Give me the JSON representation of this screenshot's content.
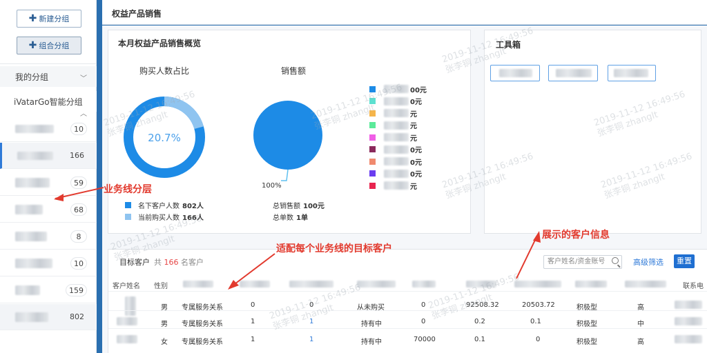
{
  "sidebar": {
    "new_group": "新建分组",
    "combine_group": "组合分组",
    "my_groups": "我的分组",
    "smart_groups": "iVatarGo智能分组",
    "counts": [
      "10",
      "166",
      "59",
      "68",
      "8",
      "10",
      "159",
      "802"
    ]
  },
  "header": {
    "title": "权益产品销售"
  },
  "overview": {
    "title": "本月权益产品销售概览",
    "buyers_title": "购买人数占比",
    "donut_percent": "20.7%",
    "donut_fraction": 0.207,
    "sales_title": "销售额",
    "pie_label": "100%",
    "legend_total_label": "名下客户人数",
    "legend_total_value": "802人",
    "legend_buyers_label": "当前购买人数",
    "legend_buyers_value": "166人",
    "sales_total_label": "总销售额",
    "sales_total_value": "100元",
    "orders_label": "总单数",
    "orders_value": "1单",
    "colors": [
      "#1d8be6",
      "#5de0d0",
      "#f5b54b",
      "#5bea9a",
      "#f05ee6",
      "#8b2a5c",
      "#f08a6e",
      "#6a3df0",
      "#e8254f"
    ],
    "color_values": [
      "00元",
      "0元",
      "元",
      "元",
      "元",
      "0元",
      "0元",
      "0元",
      "元"
    ]
  },
  "toolbox": {
    "title": "工具箱"
  },
  "targets": {
    "title": "目标客户",
    "count_prefix": "共",
    "count": "166",
    "count_suffix": "名客户",
    "search_placeholder": "客户姓名/资金账号",
    "advanced_filter": "高级筛选",
    "reset": "重置",
    "headers": [
      "客户姓名",
      "性别",
      "联系电"
    ],
    "rows": [
      {
        "gender": "男",
        "relation": "专属服务关系",
        "c1": "0",
        "c2": "0",
        "status": "从未购买",
        "c3": "0",
        "c4": "92508.32",
        "c5": "20503.72",
        "type": "积极型",
        "level": "高"
      },
      {
        "gender": "男",
        "relation": "专属服务关系",
        "c1": "1",
        "c2": "1",
        "status": "持有中",
        "c3": "0",
        "c4": "0.2",
        "c5": "0.1",
        "type": "积极型",
        "level": "中"
      },
      {
        "gender": "女",
        "relation": "专属服务关系",
        "c1": "1",
        "c2": "1",
        "status": "持有中",
        "c3": "70000",
        "c4": "0.1",
        "c5": "0",
        "type": "积极型",
        "level": "高"
      }
    ]
  },
  "annotations": {
    "business_line": "业务线分层",
    "target_fit": "适配每个业务线的目标客户",
    "customer_info": "展示的客户信息"
  },
  "watermark": {
    "time": "2019-11-12 16:49:56",
    "name": "张李铜 zhanglt"
  }
}
